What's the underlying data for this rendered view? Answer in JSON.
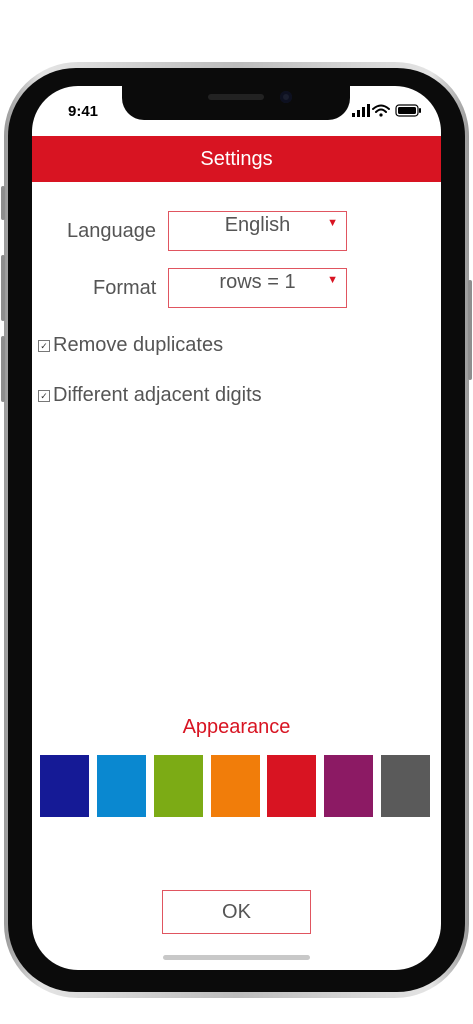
{
  "status_bar": {
    "time": "9:41"
  },
  "header": {
    "title": "Settings"
  },
  "language": {
    "label": "Language",
    "value": "English"
  },
  "format": {
    "label": "Format",
    "value": "rows = 1"
  },
  "options": [
    {
      "label": "Remove duplicates",
      "checked": true
    },
    {
      "label": "Different adjacent digits",
      "checked": true
    }
  ],
  "checkbox_glyph": "☑",
  "dropdown_arrow": "▼",
  "appearance": {
    "title": "Appearance",
    "colors": [
      "#151a96",
      "#0a88d0",
      "#7cab15",
      "#f17d0a",
      "#d81422",
      "#8c1a64",
      "#5a5a5a"
    ]
  },
  "ok_label": "OK"
}
